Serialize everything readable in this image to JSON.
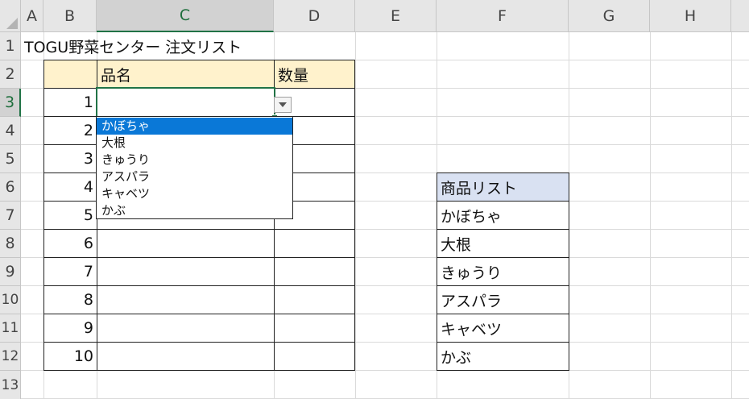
{
  "columns": [
    "A",
    "B",
    "C",
    "D",
    "E",
    "F",
    "G",
    "H"
  ],
  "rows": [
    "1",
    "2",
    "3",
    "4",
    "5",
    "6",
    "7",
    "8",
    "9",
    "10",
    "11",
    "12",
    "13"
  ],
  "title": "TOGU野菜センター 注文リスト",
  "table": {
    "headers": [
      "品名",
      "数量"
    ],
    "row_numbers": [
      "1",
      "2",
      "3",
      "4",
      "5",
      "6",
      "7",
      "8",
      "9",
      "10"
    ]
  },
  "dropdown": {
    "items": [
      "かぼちゃ",
      "大根",
      "きゅうり",
      "アスパラ",
      "キャベツ",
      "かぶ"
    ],
    "selected_index": 0
  },
  "product_list": {
    "header": "商品リスト",
    "items": [
      "かぼちゃ",
      "大根",
      "きゅうり",
      "アスパラ",
      "キャベツ",
      "かぶ"
    ]
  },
  "colors": {
    "header_fill": "#fff2cc",
    "list_header_fill": "#d9e1f2",
    "selection_green": "#217346",
    "dropdown_highlight": "#0a78d7"
  },
  "icons": {
    "dropdown_arrow": "triangle-down-icon",
    "select_all": "select-all-triangle-icon"
  }
}
